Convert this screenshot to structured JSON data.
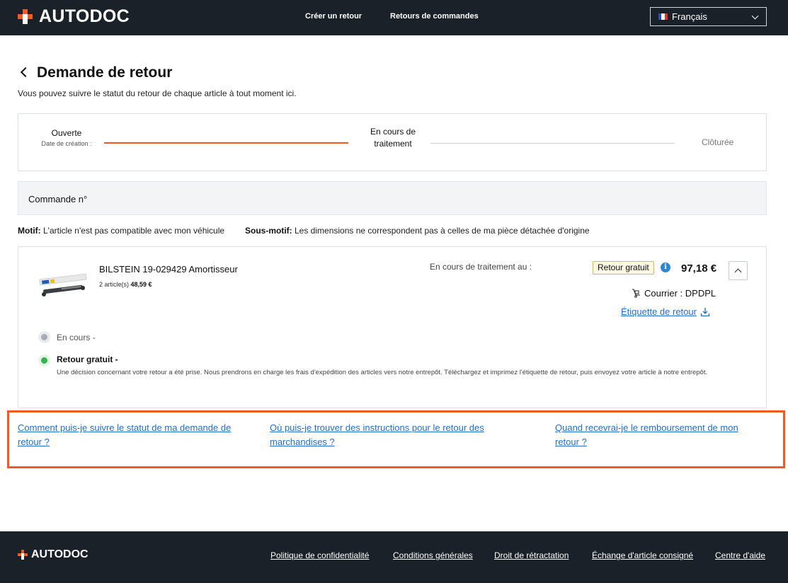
{
  "header": {
    "logo_text": "AUTODOC",
    "nav": [
      "Créer un retour",
      "Retours de commandes"
    ],
    "language": "Français"
  },
  "page": {
    "title": "Demande de retour",
    "subtitle": "Vous pouvez suivre le statut du retour de chaque article à tout moment ici."
  },
  "progress": {
    "step1_label": "Ouverte",
    "step1_sub": "Date de création :",
    "step2_label": "En cours de traitement",
    "step3_label": "Clôturée"
  },
  "order": {
    "label": "Commande n°"
  },
  "motif": {
    "label": "Motif:",
    "value": "L'article n'est pas compatible avec mon véhicule",
    "sub_label": "Sous-motif:",
    "sub_value": "Les dimensions ne correspondent pas à celles de ma pièce détachée d'origine"
  },
  "item": {
    "name": "BILSTEIN 19-029429 Amortisseur",
    "qty": "2 article(s)",
    "unit_price": "48,59 €",
    "processing_label": "En cours de traitement au :",
    "badge": "Retour gratuit",
    "info_icon": "i",
    "total": "97,18 €",
    "courier": "Courrier : DPDPL",
    "return_label_link": "Étiquette de retour",
    "status1": "En cours -",
    "status2": "Retour gratuit -",
    "status2_desc": "Une décision concernant votre retour a été prise. Nous prendrons en charge les frais d'expédition des articles vers notre entrepôt. Téléchargez et imprimez l'étiquette de retour, puis envoyez votre article à notre entrepôt."
  },
  "faq": {
    "q1_line1": "Comment puis-je suivre le statut de ma demande de",
    "q1_line2": "retour ?",
    "q2_line1": "Où puis-je trouver des instructions pour le retour des",
    "q2_line2": "marchandises ?",
    "q3_line1": "Quand recevrai-je le remboursement de mon",
    "q3_line2": "retour ?"
  },
  "footer": {
    "logo_text": "AUTODOC",
    "links": [
      "Politique de confidentialité",
      "Conditions générales",
      "Droit de rétractation",
      "Échange d'article consigné",
      "Centre d'aide"
    ]
  },
  "colors": {
    "accent": "#f15a22",
    "dark": "#1b2129",
    "link": "#1f6fc9",
    "status_done": "#35b44a"
  }
}
